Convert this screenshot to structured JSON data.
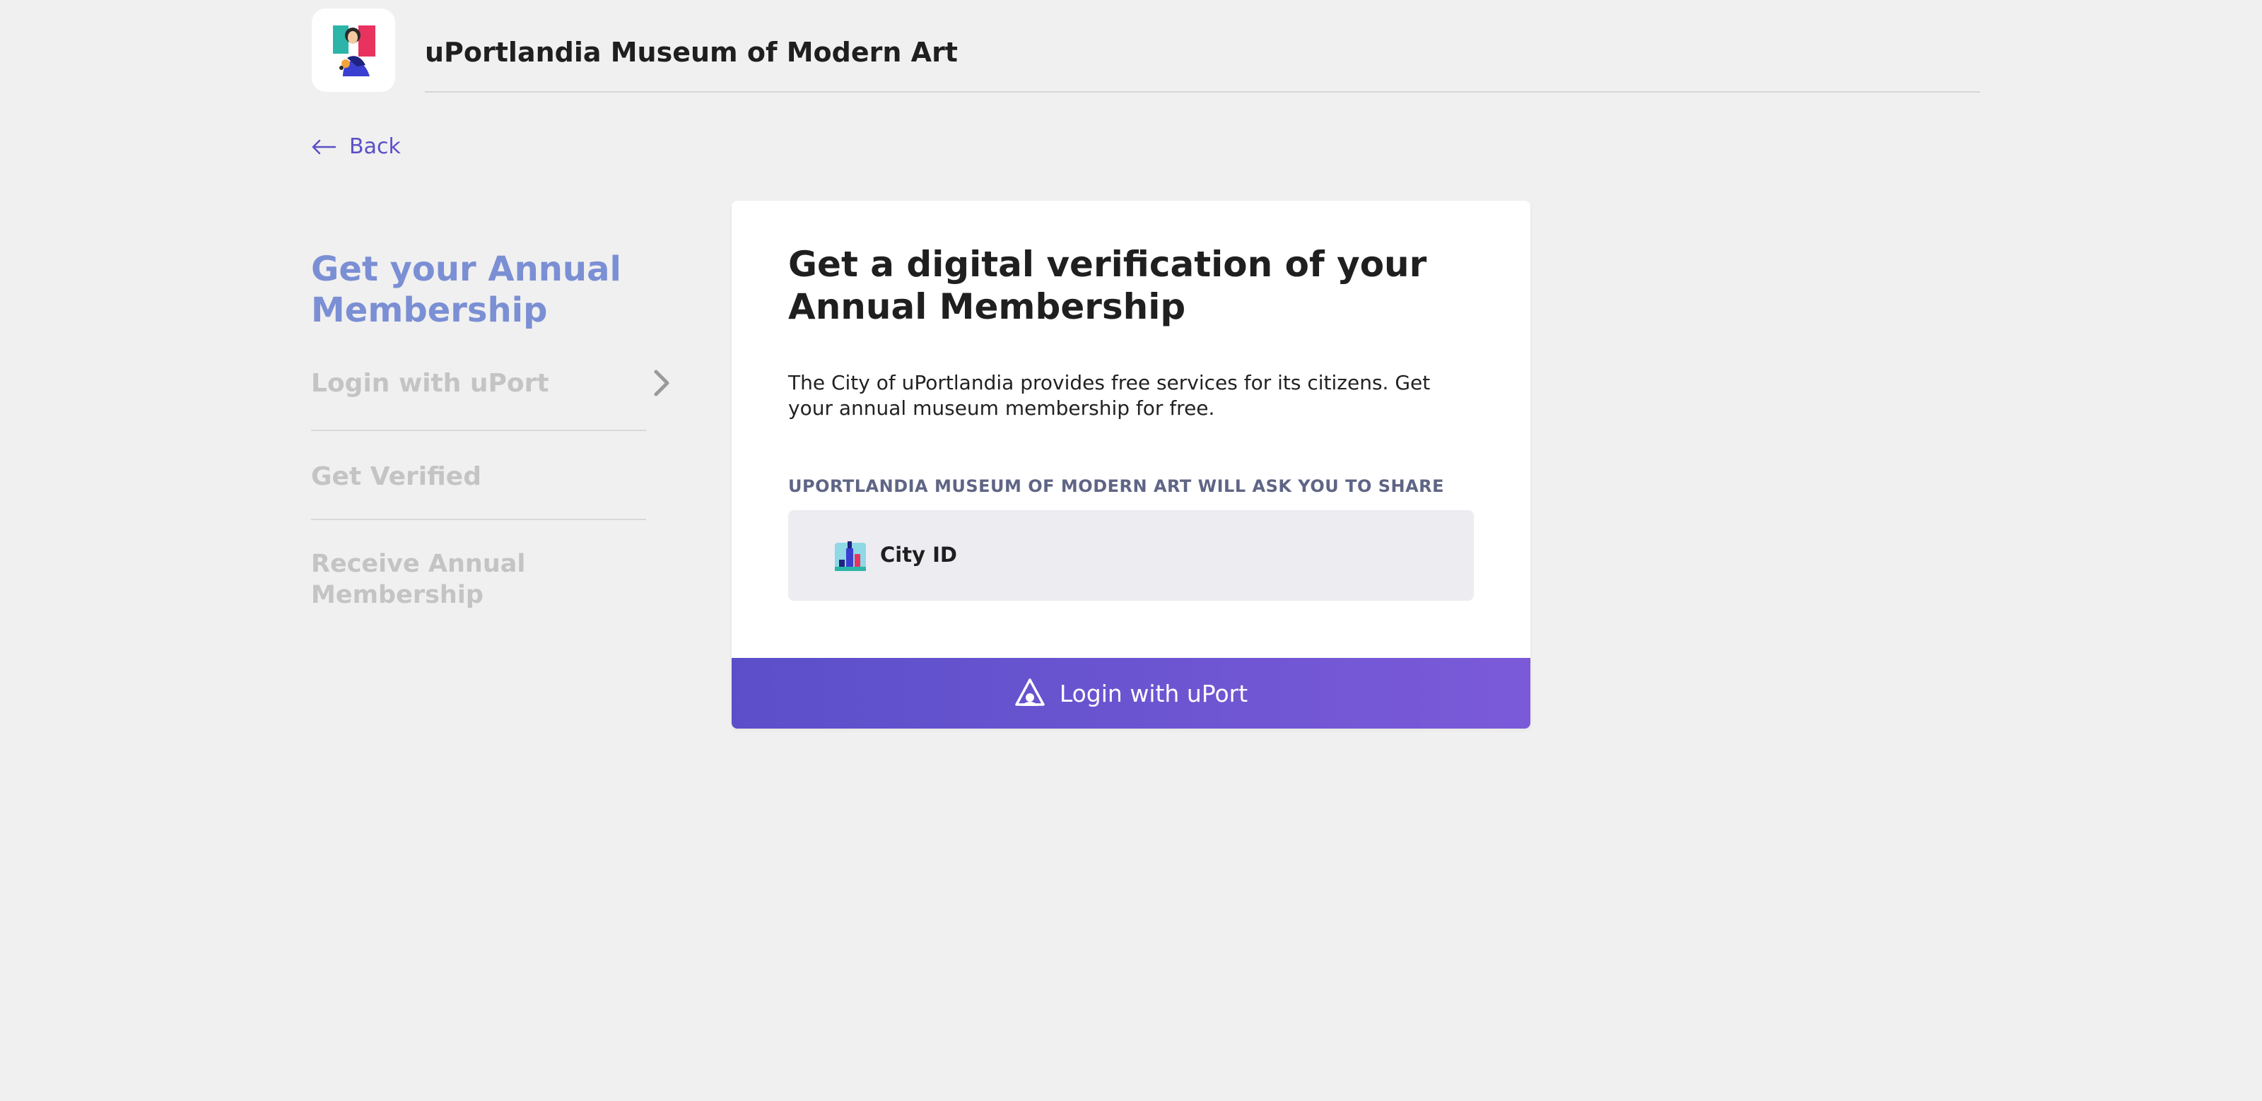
{
  "header": {
    "org_name": "uPortlandia Museum of Modern Art",
    "logo_icon": "mona-lisa-logo"
  },
  "nav": {
    "back_label": "Back"
  },
  "steps": {
    "heading": "Get your Annual Membership",
    "items": [
      {
        "label": "Login with uPort",
        "active": true
      },
      {
        "label": "Get Verified",
        "active": false
      },
      {
        "label": "Receive Annual Membership",
        "active": false
      }
    ]
  },
  "card": {
    "title": "Get a digital verification of your Annual Membership",
    "description": "The City of uPortlandia provides free services for its citizens. Get your annual museum membership for free.",
    "share_label": "UPORTLANDIA MUSEUM OF MODERN ART WILL ASK YOU TO SHARE",
    "credentials": [
      {
        "label": "City ID",
        "icon": "city-id-icon"
      }
    ],
    "login_button_label": "Login with uPort"
  },
  "colors": {
    "accent": "#5b4fc7",
    "heading_blue": "#7b8fd4",
    "button_start": "#5b4fc9",
    "button_end": "#7b5ad8",
    "background": "#f0f0f0"
  }
}
